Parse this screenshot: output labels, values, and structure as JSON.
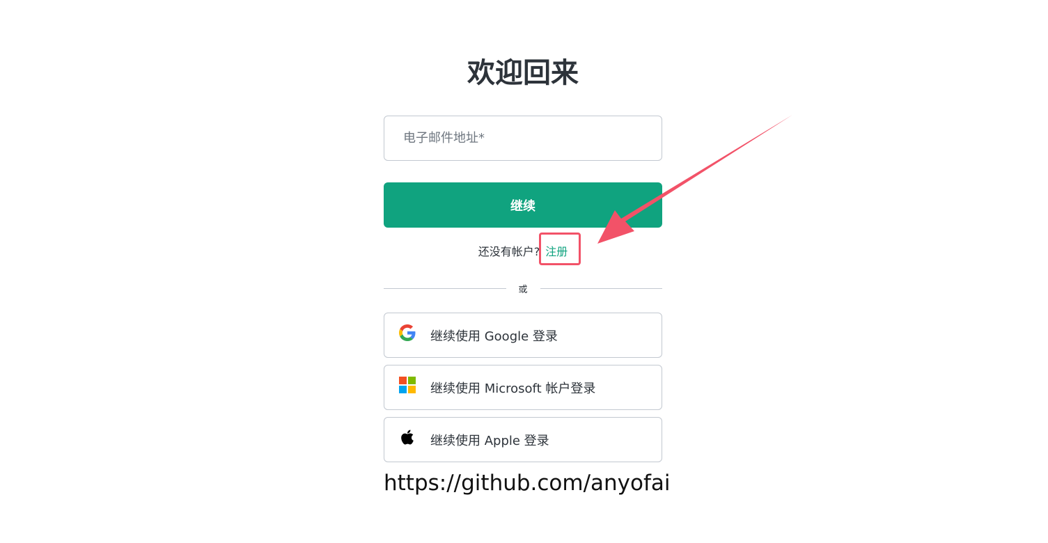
{
  "heading": "欢迎回来",
  "email": {
    "placeholder": "电子邮件地址*",
    "value": ""
  },
  "continue_label": "继续",
  "signup": {
    "prompt": "还没有帐户?",
    "link_label": "注册"
  },
  "divider_text": "或",
  "social": {
    "google_label": "继续使用 Google 登录",
    "microsoft_label": "继续使用 Microsoft 帐户登录",
    "apple_label": "继续使用 Apple 登录"
  },
  "footer_url": "https://github.com/anyofai",
  "colors": {
    "accent": "#10a37f",
    "annotation": "#f25268",
    "border": "#c2c8d0",
    "text": "#2d333a"
  },
  "icons": [
    "google-icon",
    "microsoft-icon",
    "apple-icon",
    "annotation-arrow"
  ]
}
